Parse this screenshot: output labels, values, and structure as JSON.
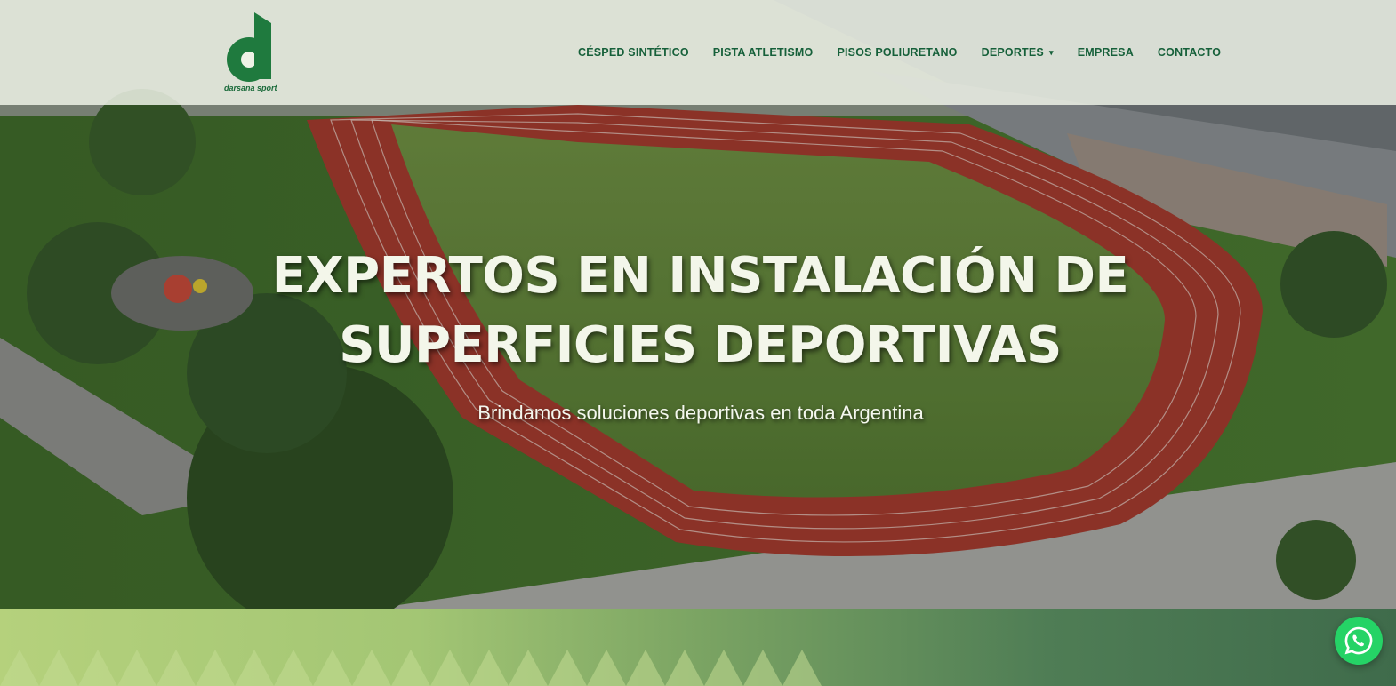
{
  "brand": {
    "name": "darsana sport",
    "logo_icon": "darsana-d-logo",
    "color": "#16603a"
  },
  "nav": {
    "items": [
      {
        "label": "CÉSPED SINTÉTICO"
      },
      {
        "label": "PISTA ATLETISMO"
      },
      {
        "label": "PISOS POLIURETANO"
      },
      {
        "label": "DEPORTES",
        "has_dropdown": true
      },
      {
        "label": "EMPRESA"
      },
      {
        "label": "CONTACTO"
      }
    ]
  },
  "hero": {
    "title_line1": "EXPERTOS EN INSTALACIÓN DE",
    "title_line2": "SUPERFICIES DEPORTIVAS",
    "subtitle": "Brindamos soluciones deportivas en toda Argentina",
    "background": "aerial-athletics-track-image"
  },
  "whatsapp": {
    "icon": "whatsapp-icon",
    "color": "#25d366"
  }
}
